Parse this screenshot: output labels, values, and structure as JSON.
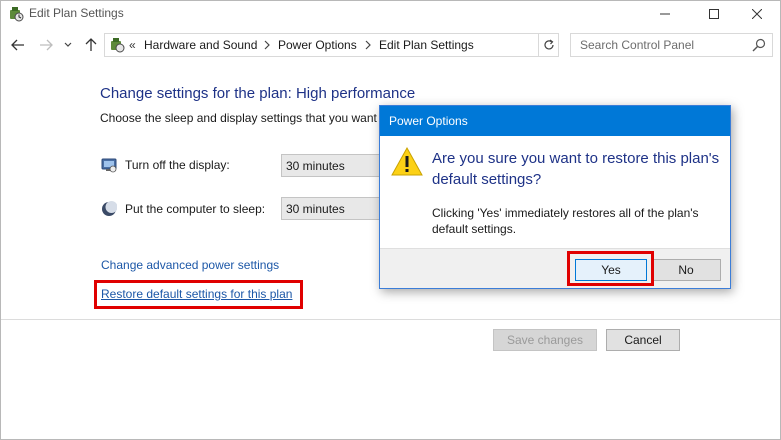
{
  "window": {
    "title": "Edit Plan Settings"
  },
  "addressbar": {
    "chevron": "«",
    "breadcrumbs": [
      "Hardware and Sound",
      "Power Options",
      "Edit Plan Settings"
    ]
  },
  "search": {
    "placeholder": "Search Control Panel"
  },
  "main": {
    "heading": "Change settings for the plan: High performance",
    "subtext": "Choose the sleep and display settings that you want your computer to use.",
    "settings": [
      {
        "label": "Turn off the display:",
        "value": "30 minutes",
        "icon": "monitor-icon"
      },
      {
        "label": "Put the computer to sleep:",
        "value": "30 minutes",
        "icon": "moon-icon"
      }
    ],
    "advanced_link": "Change advanced power settings",
    "restore_link": "Restore default settings for this plan",
    "save_label": "Save changes",
    "cancel_label": "Cancel"
  },
  "dialog": {
    "title": "Power Options",
    "main_instruction": "Are you sure you want to restore this plan's default settings?",
    "content": "Clicking 'Yes' immediately restores all of the plan's default settings.",
    "yes_label": "Yes",
    "no_label": "No",
    "icon": "warning-icon"
  },
  "colors": {
    "heading": "#1e3287",
    "link": "#1c57a7",
    "highlight": "#e00000",
    "dialog_title_bar": "#0078d7"
  }
}
